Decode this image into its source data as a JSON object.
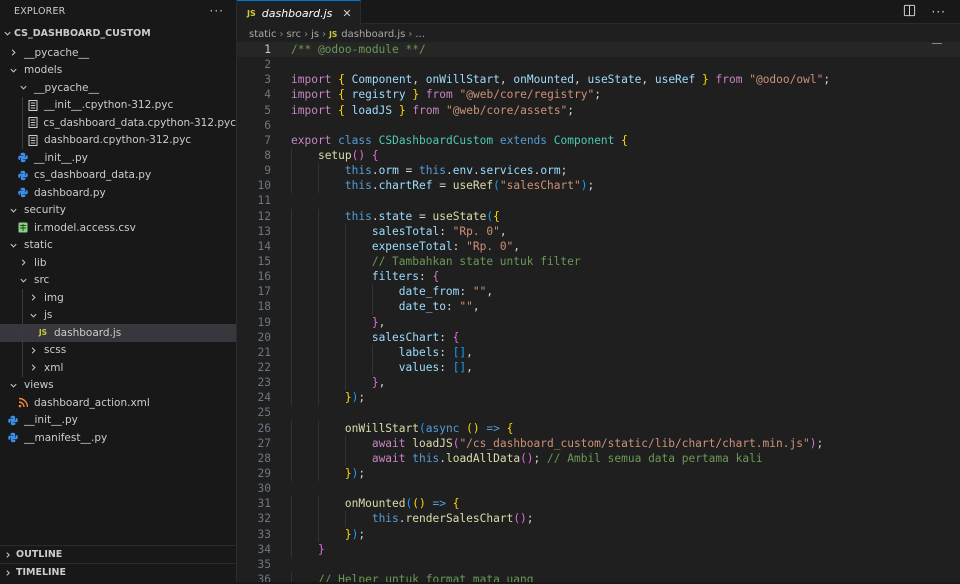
{
  "explorer": {
    "title": "EXPLORER",
    "more": "···",
    "root": "CS_DASHBOARD_CUSTOM",
    "tree": [
      {
        "label": "__pycache__",
        "kind": "folder",
        "open": false,
        "depth": 1,
        "icon": "chevron-right-icon"
      },
      {
        "label": "models",
        "kind": "folder",
        "open": true,
        "depth": 1,
        "icon": "chevron-down-icon"
      },
      {
        "label": "__pycache__",
        "kind": "folder",
        "open": true,
        "depth": 2,
        "icon": "chevron-down-icon"
      },
      {
        "label": "__init__.cpython-312.pyc",
        "kind": "pyc",
        "depth": 3,
        "icon": "pyc-file-icon"
      },
      {
        "label": "cs_dashboard_data.cpython-312.pyc",
        "kind": "pyc",
        "depth": 3,
        "icon": "pyc-file-icon"
      },
      {
        "label": "dashboard.cpython-312.pyc",
        "kind": "pyc",
        "depth": 3,
        "icon": "pyc-file-icon"
      },
      {
        "label": "__init__.py",
        "kind": "py",
        "depth": 2,
        "icon": "python-file-icon"
      },
      {
        "label": "cs_dashboard_data.py",
        "kind": "py",
        "depth": 2,
        "icon": "python-file-icon"
      },
      {
        "label": "dashboard.py",
        "kind": "py",
        "depth": 2,
        "icon": "python-file-icon"
      },
      {
        "label": "security",
        "kind": "folder",
        "open": true,
        "depth": 1,
        "icon": "chevron-down-icon"
      },
      {
        "label": "ir.model.access.csv",
        "kind": "csv",
        "depth": 2,
        "icon": "csv-file-icon"
      },
      {
        "label": "static",
        "kind": "folder",
        "open": true,
        "depth": 1,
        "icon": "chevron-down-icon"
      },
      {
        "label": "lib",
        "kind": "folder",
        "open": false,
        "depth": 2,
        "icon": "chevron-right-icon"
      },
      {
        "label": "src",
        "kind": "folder",
        "open": true,
        "depth": 2,
        "icon": "chevron-down-icon"
      },
      {
        "label": "img",
        "kind": "folder",
        "open": false,
        "depth": 3,
        "icon": "chevron-right-icon"
      },
      {
        "label": "js",
        "kind": "folder",
        "open": true,
        "depth": 3,
        "icon": "chevron-down-icon"
      },
      {
        "label": "dashboard.js",
        "kind": "js",
        "depth": 4,
        "selected": true,
        "icon": "js-file-icon"
      },
      {
        "label": "scss",
        "kind": "folder",
        "open": false,
        "depth": 3,
        "icon": "chevron-right-icon"
      },
      {
        "label": "xml",
        "kind": "folder",
        "open": false,
        "depth": 3,
        "icon": "chevron-right-icon"
      },
      {
        "label": "views",
        "kind": "folder",
        "open": true,
        "depth": 1,
        "icon": "chevron-down-icon"
      },
      {
        "label": "dashboard_action.xml",
        "kind": "xml",
        "depth": 2,
        "icon": "xml-file-icon"
      },
      {
        "label": "__init__.py",
        "kind": "py",
        "depth": 1,
        "icon": "python-file-icon"
      },
      {
        "label": "__manifest__.py",
        "kind": "py",
        "depth": 1,
        "icon": "python-file-icon"
      }
    ],
    "outline": "OUTLINE",
    "timeline": "TIMELINE"
  },
  "editor": {
    "tab": {
      "icon_text": "JS",
      "label": "dashboard.js",
      "close": "✕"
    },
    "more": "···",
    "breadcrumb": [
      "static",
      "src",
      "js"
    ],
    "breadcrumb_file": "dashboard.js",
    "breadcrumb_js": "JS",
    "breadcrumb_tail": "...",
    "current_line": 1,
    "lines": [
      [
        [
          "c-cm",
          "/** @odoo-module **/"
        ]
      ],
      [],
      [
        [
          "c-ctl",
          "import"
        ],
        [
          "c-txt",
          " "
        ],
        [
          "c-br1",
          "{"
        ],
        [
          "c-txt",
          " "
        ],
        [
          "c-var",
          "Component"
        ],
        [
          "c-txt",
          ", "
        ],
        [
          "c-var",
          "onWillStart"
        ],
        [
          "c-txt",
          ", "
        ],
        [
          "c-var",
          "onMounted"
        ],
        [
          "c-txt",
          ", "
        ],
        [
          "c-var",
          "useState"
        ],
        [
          "c-txt",
          ", "
        ],
        [
          "c-var",
          "useRef"
        ],
        [
          "c-txt",
          " "
        ],
        [
          "c-br1",
          "}"
        ],
        [
          "c-txt",
          " "
        ],
        [
          "c-ctl",
          "from"
        ],
        [
          "c-txt",
          " "
        ],
        [
          "c-str",
          "\"@odoo/owl\""
        ],
        [
          "c-txt",
          ";"
        ]
      ],
      [
        [
          "c-ctl",
          "import"
        ],
        [
          "c-txt",
          " "
        ],
        [
          "c-br1",
          "{"
        ],
        [
          "c-txt",
          " "
        ],
        [
          "c-var",
          "registry"
        ],
        [
          "c-txt",
          " "
        ],
        [
          "c-br1",
          "}"
        ],
        [
          "c-txt",
          " "
        ],
        [
          "c-ctl",
          "from"
        ],
        [
          "c-txt",
          " "
        ],
        [
          "c-str",
          "\"@web/core/registry\""
        ],
        [
          "c-txt",
          ";"
        ]
      ],
      [
        [
          "c-ctl",
          "import"
        ],
        [
          "c-txt",
          " "
        ],
        [
          "c-br1",
          "{"
        ],
        [
          "c-txt",
          " "
        ],
        [
          "c-var",
          "loadJS"
        ],
        [
          "c-txt",
          " "
        ],
        [
          "c-br1",
          "}"
        ],
        [
          "c-txt",
          " "
        ],
        [
          "c-ctl",
          "from"
        ],
        [
          "c-txt",
          " "
        ],
        [
          "c-str",
          "\"@web/core/assets\""
        ],
        [
          "c-txt",
          ";"
        ]
      ],
      [],
      [
        [
          "c-ctl",
          "export"
        ],
        [
          "c-txt",
          " "
        ],
        [
          "c-kw",
          "class"
        ],
        [
          "c-txt",
          " "
        ],
        [
          "c-cls",
          "CSDashboardCustom"
        ],
        [
          "c-txt",
          " "
        ],
        [
          "c-kw",
          "extends"
        ],
        [
          "c-txt",
          " "
        ],
        [
          "c-cls",
          "Component"
        ],
        [
          "c-txt",
          " "
        ],
        [
          "c-br1",
          "{"
        ]
      ],
      [
        [
          "c-txt",
          "    "
        ],
        [
          "c-fn",
          "setup"
        ],
        [
          "c-br2",
          "()"
        ],
        [
          "c-txt",
          " "
        ],
        [
          "c-br2",
          "{"
        ]
      ],
      [
        [
          "c-txt",
          "        "
        ],
        [
          "c-kw",
          "this"
        ],
        [
          "c-txt",
          "."
        ],
        [
          "c-var",
          "orm"
        ],
        [
          "c-txt",
          " = "
        ],
        [
          "c-kw",
          "this"
        ],
        [
          "c-txt",
          "."
        ],
        [
          "c-var",
          "env"
        ],
        [
          "c-txt",
          "."
        ],
        [
          "c-var",
          "services"
        ],
        [
          "c-txt",
          "."
        ],
        [
          "c-var",
          "orm"
        ],
        [
          "c-txt",
          ";"
        ]
      ],
      [
        [
          "c-txt",
          "        "
        ],
        [
          "c-kw",
          "this"
        ],
        [
          "c-txt",
          "."
        ],
        [
          "c-var",
          "chartRef"
        ],
        [
          "c-txt",
          " = "
        ],
        [
          "c-fn",
          "useRef"
        ],
        [
          "c-br3",
          "("
        ],
        [
          "c-str",
          "\"salesChart\""
        ],
        [
          "c-br3",
          ")"
        ],
        [
          "c-txt",
          ";"
        ]
      ],
      [],
      [
        [
          "c-txt",
          "        "
        ],
        [
          "c-kw",
          "this"
        ],
        [
          "c-txt",
          "."
        ],
        [
          "c-var",
          "state"
        ],
        [
          "c-txt",
          " = "
        ],
        [
          "c-fn",
          "useState"
        ],
        [
          "c-br3",
          "("
        ],
        [
          "c-br1",
          "{"
        ]
      ],
      [
        [
          "c-txt",
          "            "
        ],
        [
          "c-var",
          "salesTotal"
        ],
        [
          "c-txt",
          ": "
        ],
        [
          "c-str",
          "\"Rp. 0\""
        ],
        [
          "c-txt",
          ","
        ]
      ],
      [
        [
          "c-txt",
          "            "
        ],
        [
          "c-var",
          "expenseTotal"
        ],
        [
          "c-txt",
          ": "
        ],
        [
          "c-str",
          "\"Rp. 0\""
        ],
        [
          "c-txt",
          ","
        ]
      ],
      [
        [
          "c-txt",
          "            "
        ],
        [
          "c-cm",
          "// Tambahkan state untuk filter"
        ]
      ],
      [
        [
          "c-txt",
          "            "
        ],
        [
          "c-var",
          "filters"
        ],
        [
          "c-txt",
          ": "
        ],
        [
          "c-br2",
          "{"
        ]
      ],
      [
        [
          "c-txt",
          "                "
        ],
        [
          "c-var",
          "date_from"
        ],
        [
          "c-txt",
          ": "
        ],
        [
          "c-str",
          "\"\""
        ],
        [
          "c-txt",
          ","
        ]
      ],
      [
        [
          "c-txt",
          "                "
        ],
        [
          "c-var",
          "date_to"
        ],
        [
          "c-txt",
          ": "
        ],
        [
          "c-str",
          "\"\""
        ],
        [
          "c-txt",
          ","
        ]
      ],
      [
        [
          "c-txt",
          "            "
        ],
        [
          "c-br2",
          "}"
        ],
        [
          "c-txt",
          ","
        ]
      ],
      [
        [
          "c-txt",
          "            "
        ],
        [
          "c-var",
          "salesChart"
        ],
        [
          "c-txt",
          ": "
        ],
        [
          "c-br2",
          "{"
        ]
      ],
      [
        [
          "c-txt",
          "                "
        ],
        [
          "c-var",
          "labels"
        ],
        [
          "c-txt",
          ": "
        ],
        [
          "c-br3",
          "[]"
        ],
        [
          "c-txt",
          ","
        ]
      ],
      [
        [
          "c-txt",
          "                "
        ],
        [
          "c-var",
          "values"
        ],
        [
          "c-txt",
          ": "
        ],
        [
          "c-br3",
          "[]"
        ],
        [
          "c-txt",
          ","
        ]
      ],
      [
        [
          "c-txt",
          "            "
        ],
        [
          "c-br2",
          "}"
        ],
        [
          "c-txt",
          ","
        ]
      ],
      [
        [
          "c-txt",
          "        "
        ],
        [
          "c-br1",
          "}"
        ],
        [
          "c-br3",
          ")"
        ],
        [
          "c-txt",
          ";"
        ]
      ],
      [],
      [
        [
          "c-txt",
          "        "
        ],
        [
          "c-fn",
          "onWillStart"
        ],
        [
          "c-br3",
          "("
        ],
        [
          "c-kw",
          "async"
        ],
        [
          "c-txt",
          " "
        ],
        [
          "c-br1",
          "()"
        ],
        [
          "c-txt",
          " "
        ],
        [
          "c-kw",
          "=>"
        ],
        [
          "c-txt",
          " "
        ],
        [
          "c-br1",
          "{"
        ]
      ],
      [
        [
          "c-txt",
          "            "
        ],
        [
          "c-ctl",
          "await"
        ],
        [
          "c-txt",
          " "
        ],
        [
          "c-fn",
          "loadJS"
        ],
        [
          "c-br2",
          "("
        ],
        [
          "c-str",
          "\"/cs_dashboard_custom/static/lib/chart/chart.min.js\""
        ],
        [
          "c-br2",
          ")"
        ],
        [
          "c-txt",
          ";"
        ]
      ],
      [
        [
          "c-txt",
          "            "
        ],
        [
          "c-ctl",
          "await"
        ],
        [
          "c-txt",
          " "
        ],
        [
          "c-kw",
          "this"
        ],
        [
          "c-txt",
          "."
        ],
        [
          "c-fn",
          "loadAllData"
        ],
        [
          "c-br2",
          "()"
        ],
        [
          "c-txt",
          "; "
        ],
        [
          "c-cm",
          "// Ambil semua data pertama kali"
        ]
      ],
      [
        [
          "c-txt",
          "        "
        ],
        [
          "c-br1",
          "}"
        ],
        [
          "c-br3",
          ")"
        ],
        [
          "c-txt",
          ";"
        ]
      ],
      [],
      [
        [
          "c-txt",
          "        "
        ],
        [
          "c-fn",
          "onMounted"
        ],
        [
          "c-br3",
          "("
        ],
        [
          "c-br1",
          "()"
        ],
        [
          "c-txt",
          " "
        ],
        [
          "c-kw",
          "=>"
        ],
        [
          "c-txt",
          " "
        ],
        [
          "c-br1",
          "{"
        ]
      ],
      [
        [
          "c-txt",
          "            "
        ],
        [
          "c-kw",
          "this"
        ],
        [
          "c-txt",
          "."
        ],
        [
          "c-fn",
          "renderSalesChart"
        ],
        [
          "c-br2",
          "()"
        ],
        [
          "c-txt",
          ";"
        ]
      ],
      [
        [
          "c-txt",
          "        "
        ],
        [
          "c-br1",
          "}"
        ],
        [
          "c-br3",
          ")"
        ],
        [
          "c-txt",
          ";"
        ]
      ],
      [
        [
          "c-txt",
          "    "
        ],
        [
          "c-br2",
          "}"
        ]
      ],
      [],
      [
        [
          "c-txt",
          "    "
        ],
        [
          "c-cm",
          "// Helper untuk format mata uang"
        ]
      ]
    ]
  }
}
